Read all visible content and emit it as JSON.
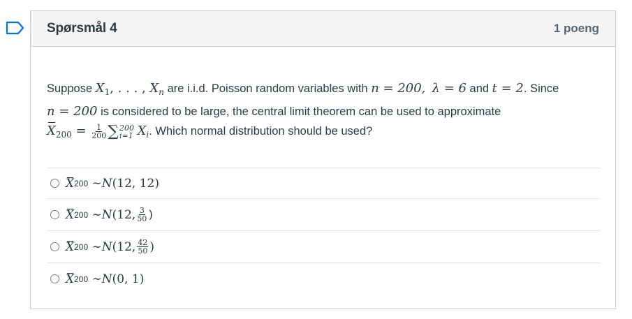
{
  "question": {
    "title": "Spørsmål 4",
    "points": "1 poeng",
    "text": {
      "p1": "Suppose ",
      "x1": "X",
      "x1_sub": "1",
      "dots": ", . . . , ",
      "xn": "X",
      "xn_sub": "n",
      "p2": " are i.i.d. Poisson random variables with ",
      "n_eq": "n = 200,",
      "lambda_eq": "λ = 6",
      "p3": " and ",
      "t_eq": "t = 2",
      "p4": ". Since",
      "n_eq2": "n = 200",
      "p5": " is considered to be large, the central limit theorem can be used to approximate",
      "xbar": "X",
      "xbar_sub": "200",
      "eq": " = ",
      "frac_num": "1",
      "frac_den": "200",
      "sigma": "∑",
      "sum_top": "200",
      "sum_bot": "i=1",
      "xi": "X",
      "xi_sub": "i",
      "p6": ". Which normal distribution should be used?"
    }
  },
  "answers": [
    {
      "id": "a",
      "prefix": "X",
      "prefix_sub": "200",
      "dist": "∼ ",
      "N": "N",
      "args": "(12, 12)"
    },
    {
      "id": "b",
      "prefix": "X",
      "prefix_sub": "200",
      "dist": "∼ ",
      "N": "N",
      "args_pre": "(12, ",
      "frac_num": "3",
      "frac_den": "50",
      "args_post": ")"
    },
    {
      "id": "c",
      "prefix": "X",
      "prefix_sub": "200",
      "dist": "∼ ",
      "N": "N",
      "args_pre": "(12, ",
      "frac_num": "42",
      "frac_den": "50",
      "args_post": ")"
    },
    {
      "id": "d",
      "prefix": "X",
      "prefix_sub": "200",
      "dist": "∼ ",
      "N": "N",
      "args": "(0, 1)"
    }
  ],
  "colors": {
    "border": "#c7cdd1",
    "header_bg": "#f5f5f5",
    "text": "#2d3b45",
    "flag": "#0b6fcc"
  },
  "icons": {
    "flag": "flag-bookmark-icon",
    "radio": "radio-unchecked-icon"
  }
}
